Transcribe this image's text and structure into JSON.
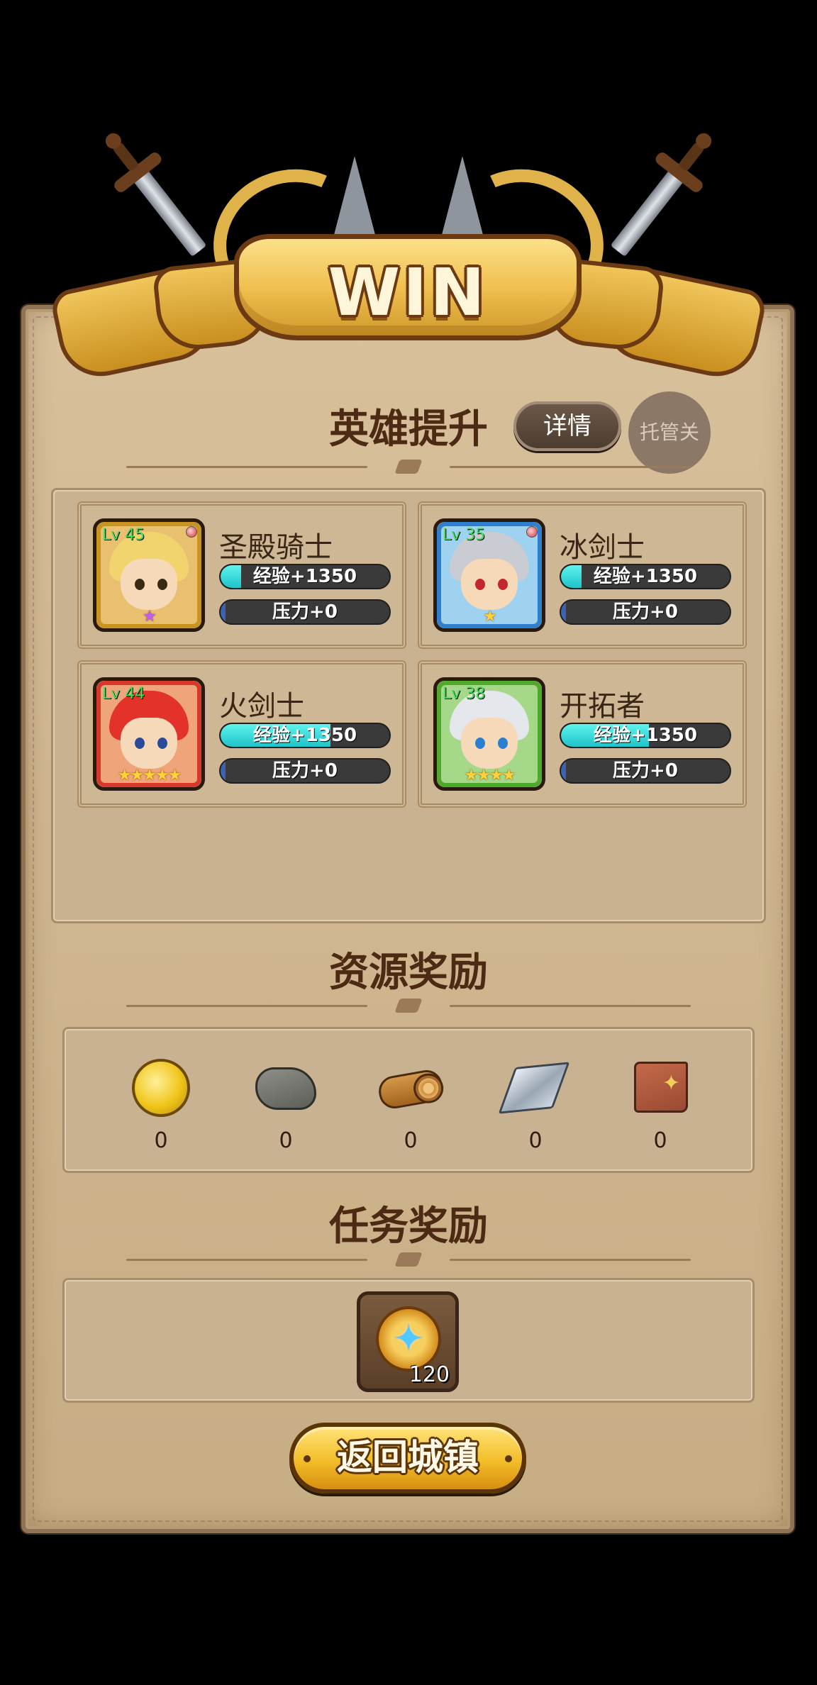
{
  "banner": {
    "title": "WIN"
  },
  "hero_section": {
    "title": "英雄提升",
    "details_button": "详情",
    "auto_button": "托管关",
    "heroes": [
      {
        "name": "圣殿骑士",
        "level": "Lv 45",
        "exp": "经验+1350",
        "pressure": "压力+0",
        "exp_fill": 0.12,
        "pressure_fill": 0.03,
        "stars": "★",
        "frame_color": "#c99320"
      },
      {
        "name": "冰剑士",
        "level": "Lv 35",
        "exp": "经验+1350",
        "pressure": "压力+0",
        "exp_fill": 0.12,
        "pressure_fill": 0.03,
        "stars": "★",
        "frame_color": "#2f7fd1"
      },
      {
        "name": "火剑士",
        "level": "Lv 44",
        "exp": "经验+1350",
        "pressure": "压力+0",
        "exp_fill": 0.65,
        "pressure_fill": 0.03,
        "stars": "★★★★★",
        "frame_color": "#d8382c"
      },
      {
        "name": "开拓者",
        "level": "Lv 38",
        "exp": "经验+1350",
        "pressure": "压力+0",
        "exp_fill": 0.52,
        "pressure_fill": 0.03,
        "stars": "★★★★",
        "frame_color": "#4faa2c"
      }
    ]
  },
  "resource_section": {
    "title": "资源奖励",
    "items": [
      {
        "icon": "gold-coin-icon",
        "count": "0"
      },
      {
        "icon": "stone-icon",
        "count": "0"
      },
      {
        "icon": "wood-log-icon",
        "count": "0"
      },
      {
        "icon": "steel-icon",
        "count": "0"
      },
      {
        "icon": "leather-icon",
        "count": "0"
      }
    ]
  },
  "task_section": {
    "title": "任务奖励",
    "item": {
      "icon": "star-medal-icon",
      "count": "120"
    }
  },
  "return_button": "返回城镇"
}
